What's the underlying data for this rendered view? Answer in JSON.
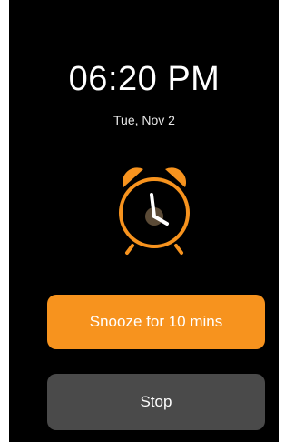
{
  "alarm": {
    "time": "06:20 PM",
    "date": "Tue, Nov 2",
    "icon": "alarm-clock-icon"
  },
  "actions": {
    "snooze_label": "Snooze for 10 mins",
    "stop_label": "Stop"
  },
  "colors": {
    "accent": "#f7931e",
    "background": "#000000",
    "stop_button": "#4a4a4a"
  }
}
